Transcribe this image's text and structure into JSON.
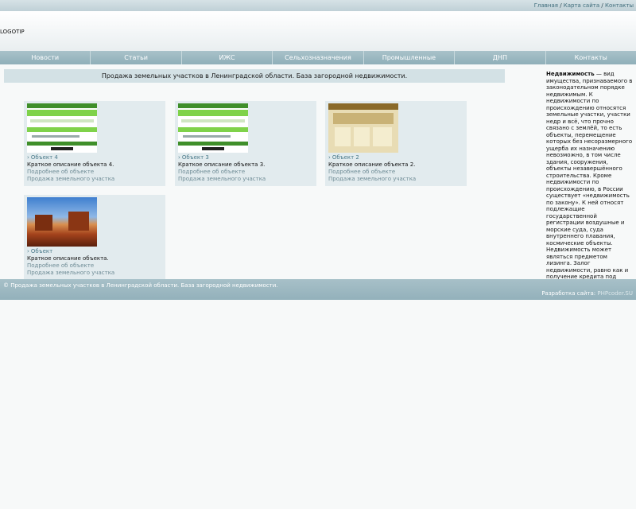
{
  "topbar": {
    "links": [
      "Главная",
      "Карта сайта",
      "Контакты"
    ],
    "separator": "/"
  },
  "header": {
    "logo": "LOGOTIP"
  },
  "nav": [
    "Новости",
    "Статьи",
    "ИЖС",
    "Сельхозназначения",
    "Промышленные",
    "ДНП",
    "Контакты"
  ],
  "banner": "Продажа земельных участков в Ленинградской области. База загородной недвижимости.",
  "objects": [
    {
      "title": "Объект 4",
      "desc": "Краткое описание объекта 4.",
      "more": "Подробнее об объекте",
      "category": "Продажа земельного участка",
      "thumb": "green-site-screenshot"
    },
    {
      "title": "Объект 3",
      "desc": "Краткое описание объекта 3.",
      "more": "Подробнее об объекте",
      "category": "Продажа земельного участка",
      "thumb": "green-site-screenshot"
    },
    {
      "title": "Объект 2",
      "desc": "Краткое описание объекта 2.",
      "more": "Подробнее об объекте",
      "category": "Продажа земельного участка",
      "thumb": "tan-site-screenshot"
    },
    {
      "title": "Объект",
      "desc": "Краткое описание объекта.",
      "more": "Подробнее об объекте",
      "category": "Продажа земельного участка",
      "thumb": "desert-photo"
    }
  ],
  "sidebar": {
    "term": "Недвижимость",
    "text": " — вид имущества, признаваемого в законодательном порядке недвижимым. К недвижимости по происхождению относятся земельные участки, участки недр и всё, что прочно связано с землёй, то есть объекты, перемещение которых без несоразмерного ущерба их назначению невозможно, в том числе здания, сооружения, объекты незавершённого строительства. Кроме недвижимости по происхождению, в России существует «недвижимость по закону». К ней относят подлежащие государственной регистрации воздушные и морские суда, суда внутреннего плавания, космические объекты. Недвижимость может являться предметом лизинга. Залог недвижимости, равно как и получение кредита под залог недвижимости принято называть ипотекой."
  },
  "footer": {
    "copyright": "© Продажа земельных участков в Ленинградской области. База загородной недвижимости.",
    "dev_label": "Разработка сайта:",
    "dev_link": "PHPcoder.SU"
  }
}
